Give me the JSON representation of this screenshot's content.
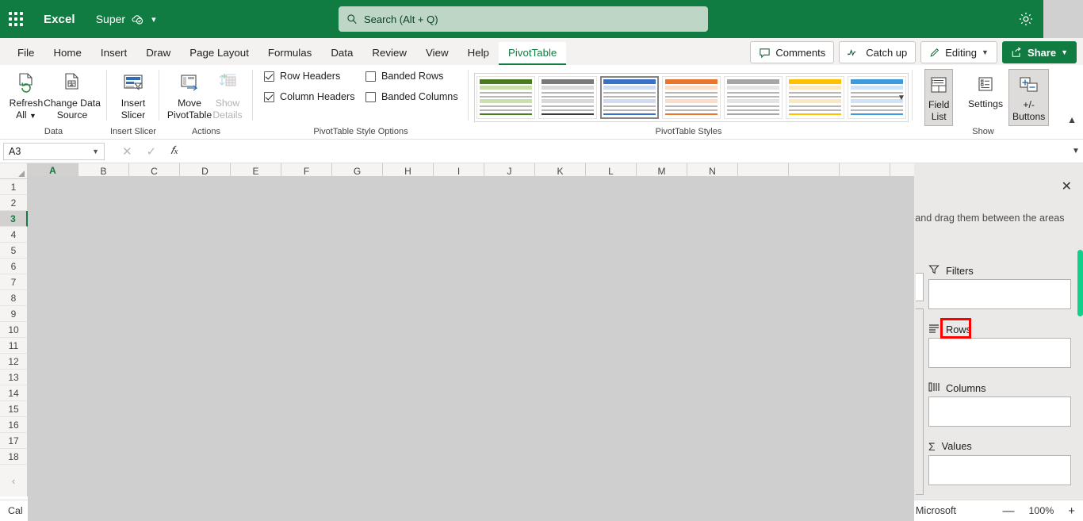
{
  "titlebar": {
    "waffle_icon": "app-launcher-icon",
    "app_name": "Excel",
    "document_name": "Super",
    "saved_icon": "cloud-saved-icon",
    "dropdown_icon": "chevron-down-icon",
    "search": {
      "icon": "search-icon",
      "placeholder": "Search (Alt + Q)",
      "value": ""
    },
    "settings_icon": "gear-icon"
  },
  "tabs": [
    {
      "label": "File",
      "active": false
    },
    {
      "label": "Home",
      "active": false
    },
    {
      "label": "Insert",
      "active": false
    },
    {
      "label": "Draw",
      "active": false
    },
    {
      "label": "Page Layout",
      "active": false
    },
    {
      "label": "Formulas",
      "active": false
    },
    {
      "label": "Data",
      "active": false
    },
    {
      "label": "Review",
      "active": false
    },
    {
      "label": "View",
      "active": false
    },
    {
      "label": "Help",
      "active": false
    },
    {
      "label": "PivotTable",
      "active": true
    }
  ],
  "tab_actions": {
    "comments": "Comments",
    "catch_up": "Catch up",
    "editing": "Editing",
    "editing_chevron": "chevron-down-icon",
    "share": "Share",
    "share_chevron": "chevron-down-icon"
  },
  "ribbon": {
    "groups": [
      {
        "name": "Data",
        "label": "Data"
      },
      {
        "name": "Insert Slicer",
        "label": "Insert Slicer"
      },
      {
        "name": "Actions",
        "label": "Actions"
      },
      {
        "name": "PivotTable Style Options",
        "label": "PivotTable Style Options"
      },
      {
        "name": "PivotTable Styles",
        "label": "PivotTable Styles"
      },
      {
        "name": "Show",
        "label": "Show"
      }
    ],
    "data_group": {
      "refresh_all_line1": "Refresh",
      "refresh_all_line2": "All",
      "refresh_chevron": "chevron-down-icon",
      "change_source_line1": "Change Data",
      "change_source_line2": "Source"
    },
    "slicer_group": {
      "insert_slicer_line1": "Insert",
      "insert_slicer_line2": "Slicer"
    },
    "actions_group": {
      "move_line1": "Move",
      "move_line2": "PivotTable",
      "show_details_line1": "Show",
      "show_details_line2": "Details",
      "show_details_disabled": true
    },
    "style_options": [
      {
        "label": "Row Headers",
        "checked": true
      },
      {
        "label": "Banded Rows",
        "checked": false
      },
      {
        "label": "Column Headers",
        "checked": true
      },
      {
        "label": "Banded Columns",
        "checked": false
      }
    ],
    "styles": [
      {
        "name": "green-style",
        "color": "#4a7c1f",
        "tint": "#c9e0a8",
        "selected": false
      },
      {
        "name": "gray-style",
        "color": "#7a7a7a",
        "tint": "#d9d9d9",
        "selected": false
      },
      {
        "name": "blue-style",
        "color": "#3b71c4",
        "tint": "#cfdcf2",
        "selected": true
      },
      {
        "name": "orange-style",
        "color": "#e8762c",
        "tint": "#fbdcc6",
        "selected": false
      },
      {
        "name": "gray2-style",
        "color": "#a6a6a6",
        "tint": "#e4e4e4",
        "selected": false
      },
      {
        "name": "yellow-style",
        "color": "#ffc000",
        "tint": "#fbe8be",
        "selected": false
      },
      {
        "name": "blue2-style",
        "color": "#3b9bdc",
        "tint": "#cfe4f6",
        "selected": false
      }
    ],
    "styles_more_icon": "chevron-down-icon",
    "show_group": {
      "field_list_line1": "Field",
      "field_list_line2": "List",
      "field_list_active": true,
      "settings_label": "Settings",
      "pm_buttons_line1": "+/-",
      "pm_buttons_line2": "Buttons",
      "pm_buttons_active": true
    },
    "collapse_icon": "chevron-up-icon"
  },
  "formula_bar": {
    "name_box_value": "A3",
    "name_box_chevron": "chevron-down-icon",
    "cancel_icon": "close-icon",
    "enter_icon": "check-icon",
    "function_icon": "fx",
    "formula_value": "",
    "expand_icon": "chevron-down-icon"
  },
  "grid": {
    "columns": [
      "A",
      "B",
      "C",
      "D",
      "E",
      "F",
      "G",
      "H",
      "I",
      "J",
      "K",
      "L",
      "M",
      "N"
    ],
    "selected_column": "A",
    "rows": [
      "1",
      "2",
      "3",
      "4",
      "5",
      "6",
      "7",
      "8",
      "9",
      "10",
      "11",
      "12",
      "13",
      "14",
      "15",
      "16",
      "17",
      "18"
    ],
    "selected_row": "3",
    "row_more_icon": "chevron-left-icon",
    "select_all_icon": "select-all-icon"
  },
  "field_pane": {
    "close_icon": "close-icon",
    "help_text": "rt and drag them between the areas",
    "areas": [
      {
        "name": "filters",
        "label": "Filters",
        "icon": "filter-icon",
        "value": ""
      },
      {
        "name": "rows",
        "label": "Rows",
        "icon": "rows-icon",
        "value": "",
        "highlighted": true
      },
      {
        "name": "columns",
        "label": "Columns",
        "icon": "columns-icon",
        "value": ""
      },
      {
        "name": "values",
        "label": "Values",
        "icon": "sigma-icon",
        "value": ""
      }
    ],
    "scrollbar_color": "#0fd18b",
    "highlight_color": "#ff0000"
  },
  "status_bar": {
    "left_text": "Cal",
    "feedback_text": "ack to Microsoft",
    "zoom_out_icon": "minus-icon",
    "zoom_level": "100%",
    "zoom_in_icon": "plus-icon"
  }
}
